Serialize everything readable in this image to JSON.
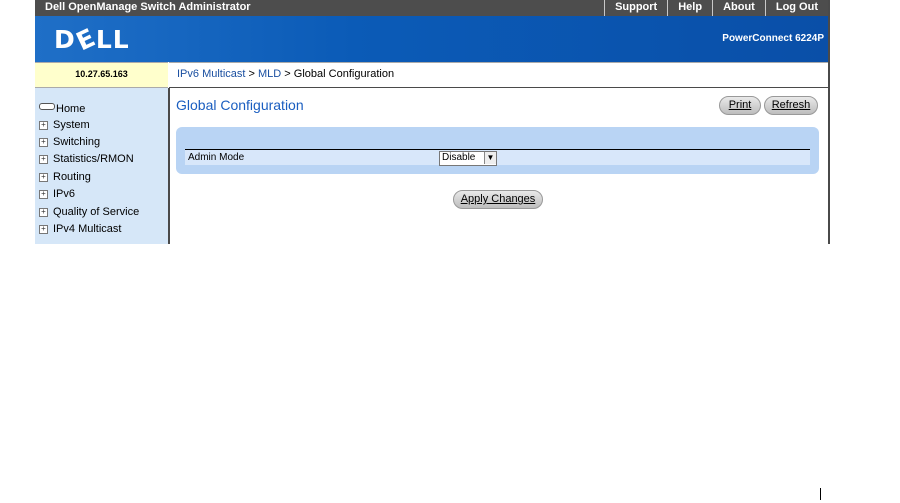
{
  "topbar": {
    "title": "Dell OpenManage Switch Administrator",
    "links": [
      "Support",
      "Help",
      "About",
      "Log Out"
    ]
  },
  "header": {
    "logo_text": "DELL",
    "product": "PowerConnect 6224P"
  },
  "ip_address": "10.27.65.163",
  "breadcrumb": {
    "item1": "IPv6 Multicast",
    "sep1": " > ",
    "item2": "MLD",
    "sep2": " > ",
    "current": "Global Configuration"
  },
  "sidebar": {
    "items": [
      {
        "label": "Home",
        "icon": "home-icon"
      },
      {
        "label": "System",
        "icon": "expand-icon"
      },
      {
        "label": "Switching",
        "icon": "expand-icon"
      },
      {
        "label": "Statistics/RMON",
        "icon": "expand-icon"
      },
      {
        "label": "Routing",
        "icon": "expand-icon"
      },
      {
        "label": "IPv6",
        "icon": "expand-icon"
      },
      {
        "label": "Quality of Service",
        "icon": "expand-icon"
      },
      {
        "label": "IPv4 Multicast",
        "icon": "expand-icon"
      }
    ]
  },
  "main": {
    "title": "Global Configuration",
    "print_label": "Print",
    "refresh_label": "Refresh",
    "admin_mode_label": "Admin Mode",
    "admin_mode_value": "Disable",
    "apply_label": "Apply Changes"
  }
}
